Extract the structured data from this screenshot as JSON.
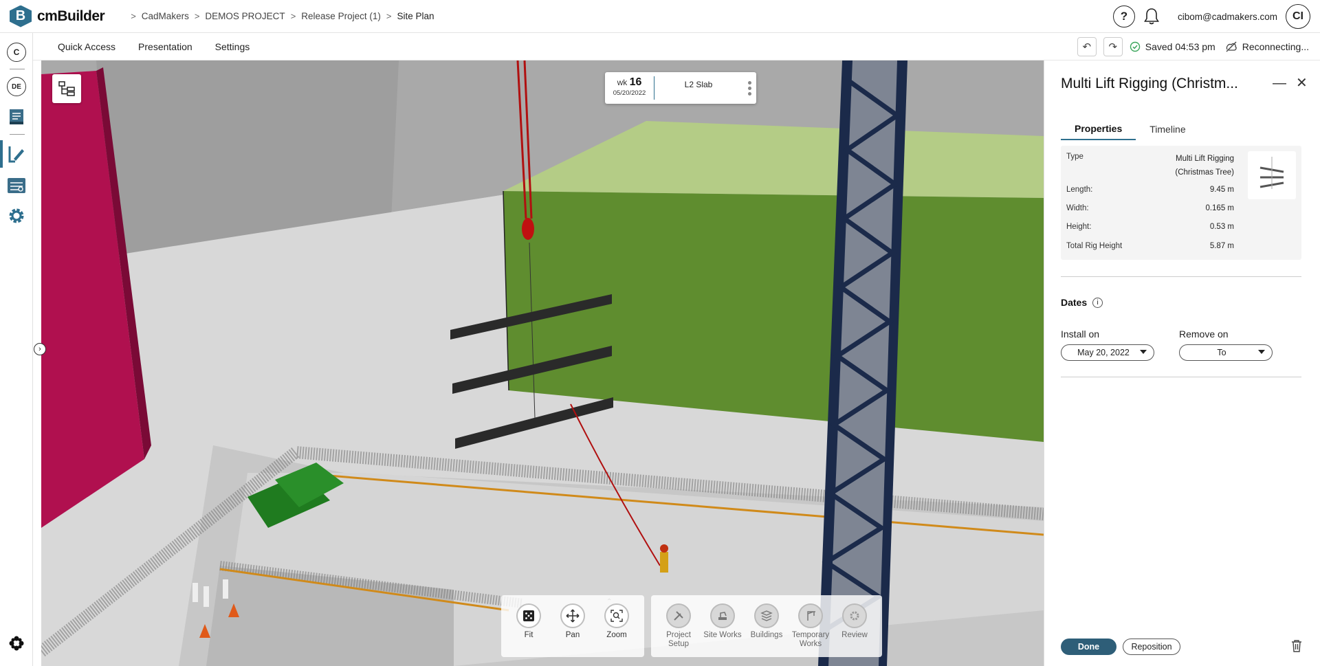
{
  "app": {
    "name": "cmBuilder",
    "logo_letter": "B"
  },
  "breadcrumb": [
    "CadMakers",
    "DEMOS PROJECT",
    "Release Project (1)",
    "Site Plan"
  ],
  "header": {
    "help_icon": "?",
    "user_email": "cibom@cadmakers.com",
    "avatar_initials": "CI"
  },
  "rail": {
    "top_badge": "C",
    "user_badge": "DE"
  },
  "menu": {
    "items": [
      "Quick Access",
      "Presentation",
      "Settings"
    ]
  },
  "status": {
    "saved": "Saved 04:53 pm",
    "connection": "Reconnecting..."
  },
  "week_card": {
    "prefix": "wk",
    "week": "16",
    "date": "05/20/2022",
    "milestone": "L2 Slab"
  },
  "toolbar": {
    "view_tools": [
      "Fit",
      "Pan",
      "Zoom"
    ],
    "sections": [
      "Project Setup",
      "Site Works",
      "Buildings",
      "Temporary Works",
      "Review"
    ]
  },
  "panel": {
    "title": "Multi Lift Rigging (Christm...",
    "tabs": [
      "Properties",
      "Timeline"
    ],
    "active_tab": "Properties",
    "properties": [
      {
        "label": "Type",
        "value": "Multi Lift Rigging (Christmas Tree)"
      },
      {
        "label": "Length:",
        "value": "9.45 m"
      },
      {
        "label": "Width:",
        "value": "0.165 m"
      },
      {
        "label": "Height:",
        "value": "0.53 m"
      },
      {
        "label": "Total Rig Height",
        "value": "5.87 m"
      }
    ],
    "dates_heading": "Dates",
    "install_label": "Install on",
    "install_value": "May 20, 2022",
    "remove_label": "Remove on",
    "remove_value": "To",
    "done_label": "Done",
    "reposition_label": "Reposition"
  },
  "colors": {
    "accent": "#2e6f8e",
    "slab_top": "#aec77f",
    "slab_side": "#5e8a2e",
    "crane": "#1b2a4a",
    "wall_pink": "#c0105a"
  }
}
